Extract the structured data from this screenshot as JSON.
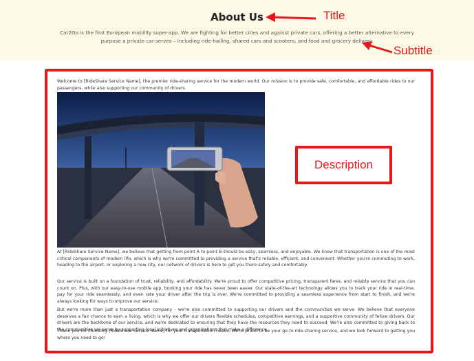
{
  "hero": {
    "title": "About Us",
    "subtitle": "Car2Go is the first European mobility super-app. We are fighting for better cities and against private cars, offering a better alternative to every purpose a private car serves – including ride-hailing, shared cars and scooters, and food and grocery delivery."
  },
  "annotations": {
    "title_label": "Title",
    "subtitle_label": "Subtitle",
    "description_label": "Description",
    "color": "#e8151b"
  },
  "description": {
    "intro": "Welcome to [RideShare Service Name], the premier ride-sharing service for the modern world. Our mission is to provide safe, comfortable, and affordable rides to our passengers, while also supporting our community of drivers.",
    "image_alt": "Hand holding a phone photographing a road under a bridge at dusk",
    "para1": "At [RideShare Service Name], we believe that getting from point A to point B should be easy, seamless, and enjoyable. We know that transportation is one of the most critical components of modern life, which is why we're committed to providing a service that's reliable, efficient, and convenient. Whether you're commuting to work, heading to the airport, or exploring a new city, our network of drivers is here to get you there safely and comfortably.",
    "para2": "Our service is built on a foundation of trust, reliability, and affordability. We're proud to offer competitive pricing, transparent fares, and reliable service that you can count on. Plus, with our easy-to-use mobile app, booking your ride has never been easier. Our state-of-the-art technology allows you to track your ride in real-time, pay for your ride seamlessly, and even rate your driver after the trip is over. We're committed to providing a seamless experience from start to finish, and we're always looking for ways to improve our service.",
    "para3": "But we're more than just a transportation company - we're also committed to supporting our drivers and the communities we serve. We believe that everyone deserves a fair chance to earn a living, which is why we offer our drivers flexible schedules, competitive earnings, and a supportive community of fellow drivers. Our drivers are the backbone of our service, and we're dedicated to ensuring that they have the resources they need to succeed. We're also committed to giving back to the communities we serve by supporting local initiatives and organizations that make a difference.",
    "para4": "Thank you for choosing [RideShare Service Name] for your transportation needs. We're proud to be your go-to ride-sharing service, and we look forward to getting you where you need to go!"
  }
}
